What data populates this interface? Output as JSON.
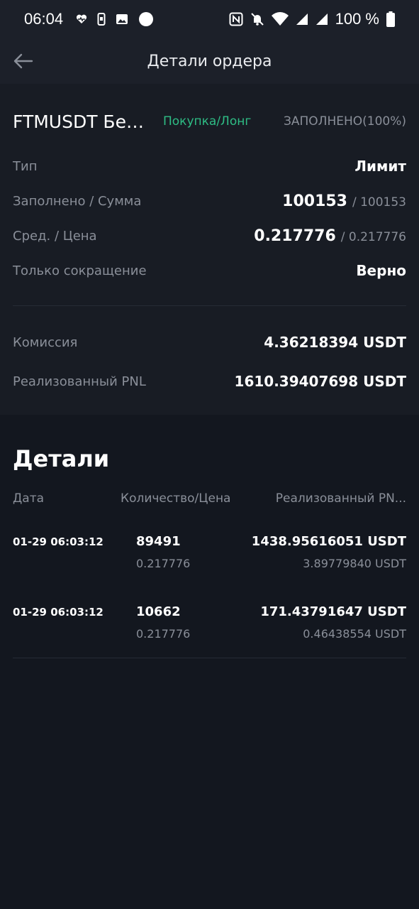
{
  "status_bar": {
    "time": "06:04",
    "battery": "100 %",
    "icons_left": [
      "heart-icon",
      "phone-icon",
      "image-icon",
      "dot-icon"
    ],
    "icons_right": [
      "nfc-icon",
      "mute-icon",
      "wifi-icon",
      "signal-icon",
      "signal-icon",
      "battery-icon"
    ]
  },
  "header": {
    "title": "Детали ордера",
    "back_icon": "arrow-left-icon"
  },
  "order": {
    "symbol": "FTMUSDT Бес...",
    "side": "Покупка/Лонг",
    "status": "ЗАПОЛНЕНО(100%)",
    "type_label": "Тип",
    "type_value": "Лимит",
    "filled_label": "Заполнено / Сумма",
    "filled_value": "100153",
    "amount_value": "/ 100153",
    "avg_label": "Сред. / Цена",
    "avg_value": "0.217776",
    "price_value": "/ 0.217776",
    "reduce_label": "Только сокращение",
    "reduce_value": "Верно",
    "fee_label": "Комиссия",
    "fee_value": "4.36218394 USDT",
    "pnl_label": "Реализованный PNL",
    "pnl_value": "1610.39407698 USDT"
  },
  "details": {
    "title": "Детали",
    "columns": [
      "Дата",
      "Количество/Цена",
      "Реализованный PN..."
    ],
    "rows": [
      {
        "date": "01-29 06:03:12",
        "qty": "89491",
        "price": "0.217776",
        "pnl": "1438.95616051 USDT",
        "fee": "3.89779840 USDT"
      },
      {
        "date": "01-29 06:03:12",
        "qty": "10662",
        "price": "0.217776",
        "pnl": "171.43791647 USDT",
        "fee": "0.46438554 USDT"
      }
    ]
  },
  "colors": {
    "background": "#13171f",
    "card": "#181c24",
    "buy_green": "#2ebd85",
    "muted": "#8a8f99"
  }
}
